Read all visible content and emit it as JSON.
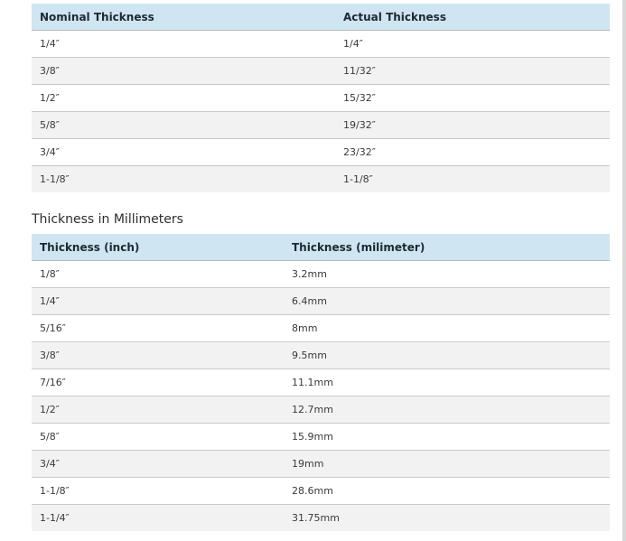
{
  "table1": {
    "headers": [
      "Nominal Thickness",
      "Actual Thickness"
    ],
    "rows": [
      [
        "1/4″",
        "1/4″"
      ],
      [
        "3/8″",
        "11/32″"
      ],
      [
        "1/2″",
        "15/32″"
      ],
      [
        "5/8″",
        "19/32″"
      ],
      [
        "3/4″",
        "23/32″"
      ],
      [
        "1-1/8″",
        "1-1/8″"
      ]
    ]
  },
  "section2": {
    "heading": "Thickness in Millimeters"
  },
  "table2": {
    "headers": [
      "Thickness (inch)",
      "Thickness (milimeter)"
    ],
    "rows": [
      [
        "1/8″",
        "3.2mm"
      ],
      [
        "1/4″",
        "6.4mm"
      ],
      [
        "5/16″",
        "8mm"
      ],
      [
        "3/8″",
        "9.5mm"
      ],
      [
        "7/16″",
        "11.1mm"
      ],
      [
        "1/2″",
        "12.7mm"
      ],
      [
        "5/8″",
        "15.9mm"
      ],
      [
        "3/4″",
        "19mm"
      ],
      [
        "1-1/8″",
        "28.6mm"
      ],
      [
        "1-1/4″",
        "31.75mm"
      ]
    ]
  },
  "colors": {
    "header_background": "#cfe5f2",
    "alt_row_background": "#f2f2f2",
    "row_border": "#c9c9c9"
  }
}
